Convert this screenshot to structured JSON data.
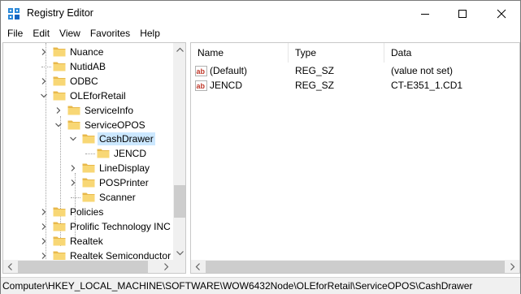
{
  "window": {
    "title": "Registry Editor",
    "controls": {
      "minimize": "minimize",
      "maximize": "maximize",
      "close": "close"
    }
  },
  "menu": [
    "File",
    "Edit",
    "View",
    "Favorites",
    "Help"
  ],
  "tree": {
    "items": [
      {
        "label": "Nuance",
        "level": 1,
        "expander": "collapsed"
      },
      {
        "label": "NutidAB",
        "level": 1,
        "expander": "none"
      },
      {
        "label": "ODBC",
        "level": 1,
        "expander": "collapsed"
      },
      {
        "label": "OLEforRetail",
        "level": 1,
        "expander": "expanded"
      },
      {
        "label": "ServiceInfo",
        "level": 2,
        "expander": "collapsed"
      },
      {
        "label": "ServiceOPOS",
        "level": 2,
        "expander": "expanded"
      },
      {
        "label": "CashDrawer",
        "level": 3,
        "expander": "expanded",
        "selected": true
      },
      {
        "label": "JENCD",
        "level": 4,
        "expander": "none"
      },
      {
        "label": "LineDisplay",
        "level": 3,
        "expander": "collapsed"
      },
      {
        "label": "POSPrinter",
        "level": 3,
        "expander": "collapsed"
      },
      {
        "label": "Scanner",
        "level": 3,
        "expander": "none"
      },
      {
        "label": "Policies",
        "level": 1,
        "expander": "collapsed"
      },
      {
        "label": "Prolific Technology INC",
        "level": 1,
        "expander": "collapsed"
      },
      {
        "label": "Realtek",
        "level": 1,
        "expander": "collapsed"
      },
      {
        "label": "Realtek Semiconductor C",
        "level": 1,
        "expander": "collapsed"
      }
    ]
  },
  "list": {
    "columns": [
      "Name",
      "Type",
      "Data"
    ],
    "rows": [
      {
        "name": "(Default)",
        "type": "REG_SZ",
        "data": "(value not set)",
        "icon": "string-value-icon"
      },
      {
        "name": "JENCD",
        "type": "REG_SZ",
        "data": "CT-E351_1.CD1",
        "icon": "string-value-icon"
      }
    ]
  },
  "status": {
    "path": "Computer\\HKEY_LOCAL_MACHINE\\SOFTWARE\\WOW6432Node\\OLEforRetail\\ServiceOPOS\\CashDrawer"
  },
  "colors": {
    "folder": "#f8d775",
    "selection": "#cce8ff",
    "ab_icon": "#c0392b"
  }
}
